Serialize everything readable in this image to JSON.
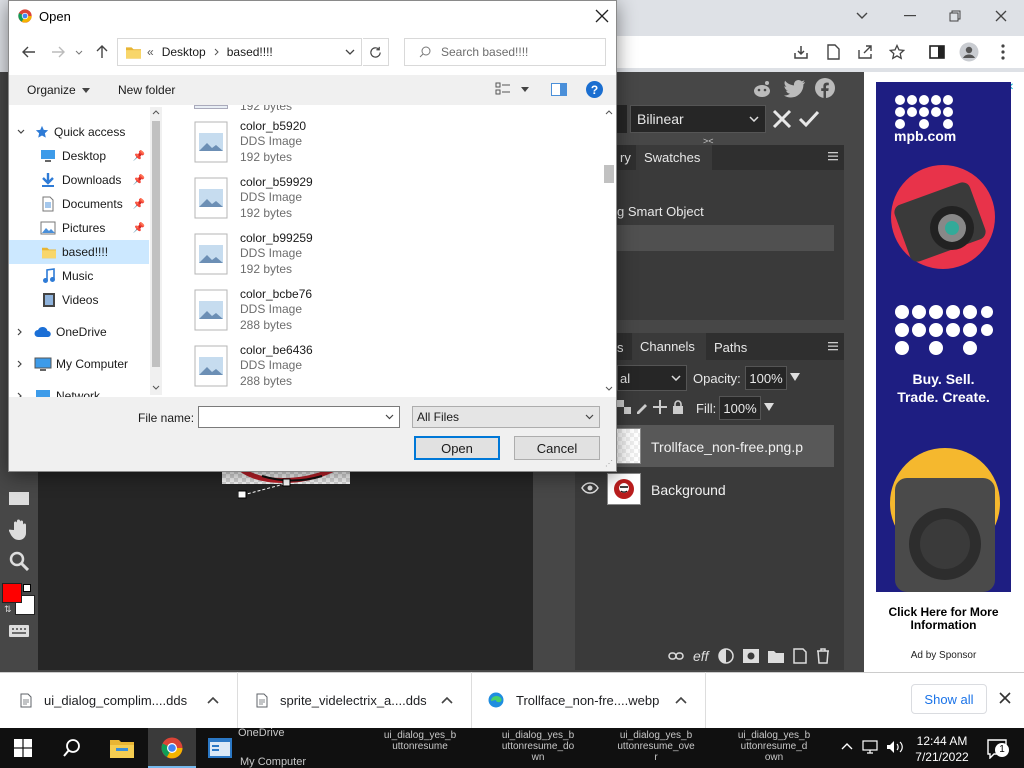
{
  "dialog": {
    "title": "Open",
    "breadcrumb": {
      "prefix": "«",
      "segments": [
        "Desktop",
        "based!!!!"
      ]
    },
    "search_placeholder": "Search based!!!!",
    "organize_label": "Organize",
    "new_folder_label": "New folder",
    "help_label": "?",
    "nav": {
      "quick_access": "Quick access",
      "items": [
        {
          "label": "Desktop",
          "icon": "desktop-icon"
        },
        {
          "label": "Downloads",
          "icon": "download-arrow-icon"
        },
        {
          "label": "Documents",
          "icon": "documents-icon"
        },
        {
          "label": "Pictures",
          "icon": "pictures-icon"
        },
        {
          "label": "based!!!!",
          "icon": "folder-icon"
        },
        {
          "label": "Music",
          "icon": "music-icon"
        },
        {
          "label": "Videos",
          "icon": "videos-icon"
        }
      ],
      "onedrive": "OneDrive",
      "my_computer": "My Computer",
      "network": "Network"
    },
    "partial_top_meta": "192 bytes",
    "files": [
      {
        "name": "color_b5920",
        "type": "DDS Image",
        "size": "192 bytes"
      },
      {
        "name": "color_b59929",
        "type": "DDS Image",
        "size": "192 bytes"
      },
      {
        "name": "color_b99259",
        "type": "DDS Image",
        "size": "192 bytes"
      },
      {
        "name": "color_bcbe76",
        "type": "DDS Image",
        "size": "288 bytes"
      },
      {
        "name": "color_be6436",
        "type": "DDS Image",
        "size": "288 bytes"
      }
    ],
    "file_name_label": "File name:",
    "file_name_value": "",
    "filter_value": "All Files",
    "open_button": "Open",
    "cancel_button": "Cancel"
  },
  "photopea": {
    "interp_select": "Bilinear",
    "tabs_top": [
      "ry",
      "Swatches"
    ],
    "smart_object": "g Smart Object",
    "tabs_layers": [
      "s",
      "Channels",
      "Paths"
    ],
    "blend_mode": "al",
    "opacity_label": "Opacity:",
    "opacity_value": "100%",
    "fill_label": "Fill:",
    "fill_value": "100%",
    "layers": [
      "Trollface_non-free.png.p",
      "Background"
    ],
    "layer_footer_eff": "eff"
  },
  "ad": {
    "brand": "mpb.com",
    "tagline1": "Buy. Sell.",
    "tagline2": "Trade. Create.",
    "cta1": "Click Here for More",
    "cta2": "Information",
    "sponsor": "Ad by Sponsor",
    "adchoices": "▷",
    "close": "✕"
  },
  "downloads": {
    "items": [
      "ui_dialog_complim....dds",
      "sprite_videlectrix_a....dds",
      "Trollface_non-fre....webp"
    ],
    "show_all": "Show all"
  },
  "taskbar": {
    "time": "12:44 AM",
    "date": "7/21/2022",
    "notif_count": "1",
    "desktop_ghost": [
      "OneDrive",
      "My Computer",
      "ui_dialog_yes_b\nuttonresume",
      "ui_dialog_yes_b\nuttonresume_do\nwn",
      "ui_dialog_yes_b\nuttonresume_ove\nr",
      "ui_dialog_yes_b\nuttonresume_d\nown"
    ]
  },
  "colors": {
    "selection": "#cce8ff",
    "accent": "#0078d7",
    "photopea_bg": "#474747",
    "ad_blue": "#1e1e82",
    "ad_red": "#e8334a"
  }
}
